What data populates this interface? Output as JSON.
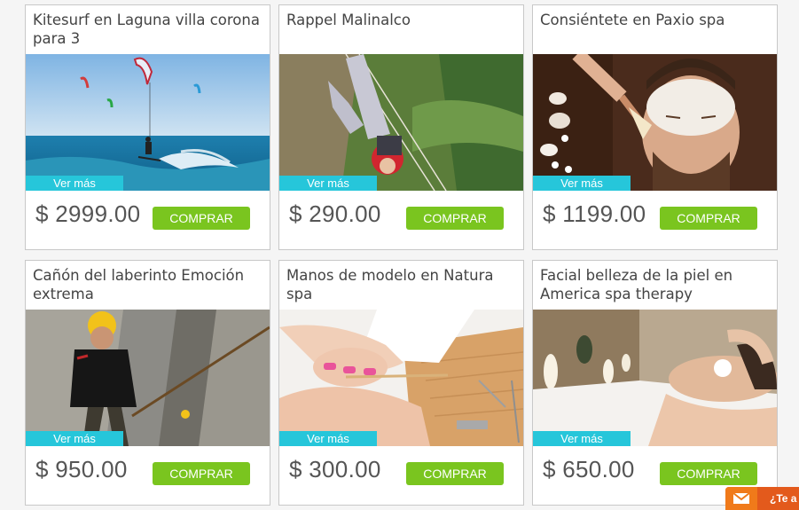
{
  "products": [
    {
      "title": "Kitesurf en Laguna villa corona para 3",
      "price": "$ 2999.00",
      "image": "kitesurf-photo"
    },
    {
      "title": "Rappel Malinalco",
      "price": "$ 290.00",
      "image": "rappel-photo"
    },
    {
      "title": "Consiéntete en Paxio spa",
      "price": "$ 1199.00",
      "image": "facial-mask-photo"
    },
    {
      "title": "Cañón del laberinto Emoción extrema",
      "price": "$ 950.00",
      "image": "climber-photo"
    },
    {
      "title": "Manos de modelo en Natura spa",
      "price": "$ 300.00",
      "image": "manicure-photo"
    },
    {
      "title": "Facial belleza de la piel en America spa therapy",
      "price": "$ 650.00",
      "image": "facial-spa-photo"
    }
  ],
  "labels": {
    "more": "Ver más",
    "buy": "COMPRAR"
  },
  "chat": {
    "label": "¿Te a",
    "icon": "envelope-icon"
  },
  "colors": {
    "accent_button": "#7ac51f",
    "more_tag": "#26c6da",
    "chat_tab": "#e35a1c"
  }
}
